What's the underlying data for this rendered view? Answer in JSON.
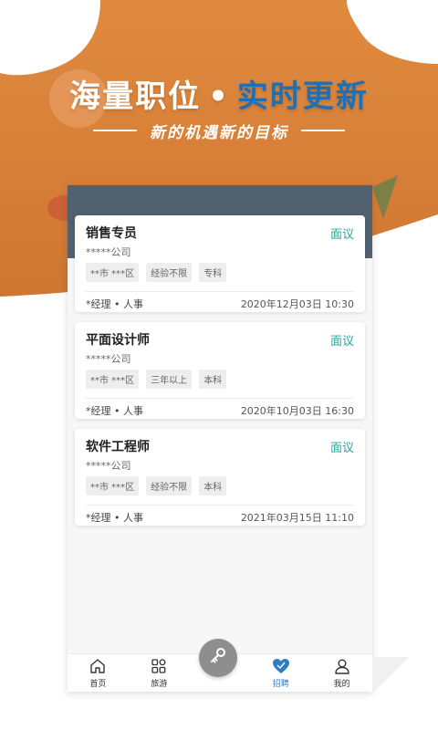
{
  "banner": {
    "headline_part1": "海量职位",
    "headline_sep": "•",
    "headline_part2": "实时更新",
    "subline": "新的机遇新的目标"
  },
  "jobs": [
    {
      "title": "销售专员",
      "salary": "面议",
      "company": "*****公司",
      "tags": [
        "**市 ***区",
        "经验不限",
        "专科"
      ],
      "contact": "*经理 • 人事",
      "time": "2020年12月03日 10:30"
    },
    {
      "title": "平面设计师",
      "salary": "面议",
      "company": "*****公司",
      "tags": [
        "**市 ***区",
        "三年以上",
        "本科"
      ],
      "contact": "*经理 • 人事",
      "time": "2020年10月03日 16:30"
    },
    {
      "title": "软件工程师",
      "salary": "面议",
      "company": "*****公司",
      "tags": [
        "**市 ***区",
        "经验不限",
        "本科"
      ],
      "contact": "*经理 • 人事",
      "time": "2021年03月15日 11:10"
    }
  ],
  "tabbar": {
    "items": [
      {
        "label": "首页",
        "icon": "home-icon"
      },
      {
        "label": "旅游",
        "icon": "grid-icon"
      },
      {
        "label": "",
        "icon": "key-icon"
      },
      {
        "label": "招聘",
        "icon": "heart-icon",
        "active": true
      },
      {
        "label": "我的",
        "icon": "user-icon"
      }
    ]
  },
  "colors": {
    "orange": "#d9823a",
    "accent_blue": "#1f6fb5",
    "salary_teal": "#2aa69a",
    "phone_band": "#52616f",
    "active_tab": "#2f7cc1"
  }
}
